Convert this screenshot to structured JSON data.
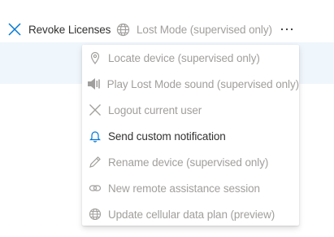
{
  "toolbar": {
    "revoke_label": "Revoke Licenses",
    "lost_mode_label": "Lost Mode (supervised only)",
    "more_label": "···"
  },
  "menu": {
    "items": [
      {
        "label": "Locate device (supervised only)",
        "icon": "location-pin-icon",
        "enabled": false
      },
      {
        "label": "Play Lost Mode sound (supervised only)",
        "icon": "speaker-icon",
        "enabled": false
      },
      {
        "label": "Logout current user",
        "icon": "close-x-icon",
        "enabled": false
      },
      {
        "label": "Send custom notification",
        "icon": "bell-icon",
        "enabled": true
      },
      {
        "label": "Rename device (supervised only)",
        "icon": "pencil-icon",
        "enabled": false
      },
      {
        "label": "New remote assistance session",
        "icon": "link-icon",
        "enabled": false
      },
      {
        "label": "Update cellular data plan (preview)",
        "icon": "globe-icon",
        "enabled": false
      }
    ]
  },
  "colors": {
    "accent": "#0078d4",
    "text": "#323130",
    "disabled": "#a19f9d",
    "band": "#eff6fc"
  }
}
